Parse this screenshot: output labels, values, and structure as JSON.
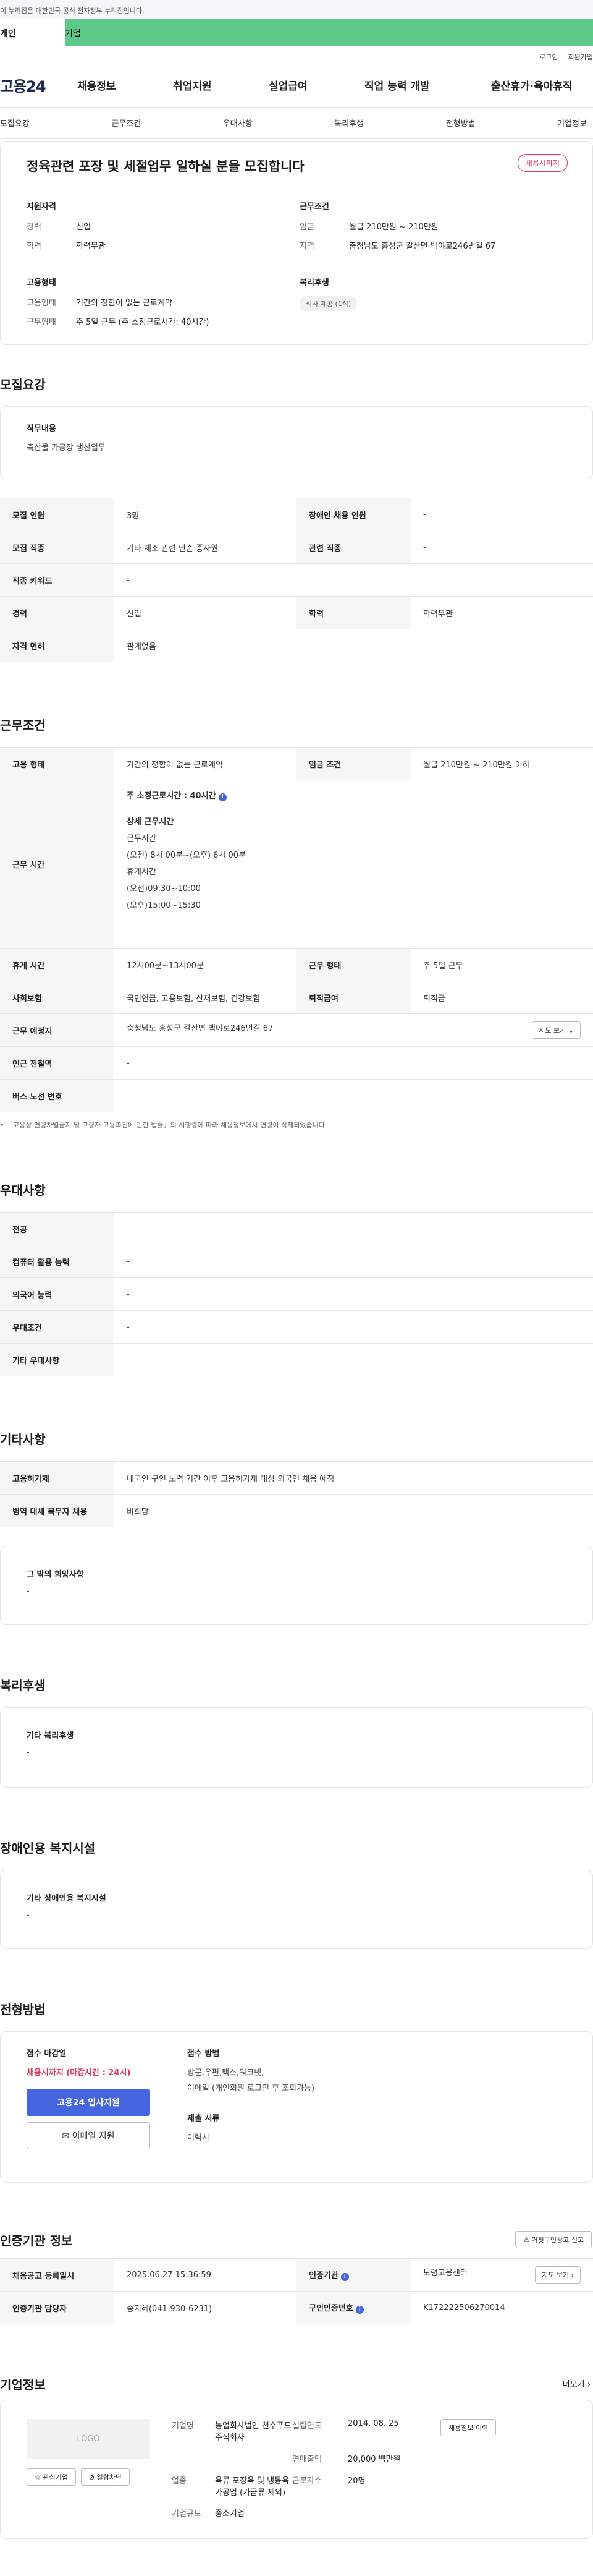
{
  "gov_bar": "이 누리집은 대한민국 공식 전자정부 누리집입니다.",
  "type_tabs": {
    "person": "개인",
    "business": "기업"
  },
  "top_links": {
    "login": "로그인",
    "signup": "회원가입"
  },
  "gnb": {
    "logo": "고용24",
    "items": [
      "채용정보",
      "취업지원",
      "실업급여",
      "직업 능력 개발",
      "출산휴가·육아휴직"
    ]
  },
  "sub_tabs": [
    "모집요강",
    "근무조건",
    "우대사항",
    "복리후생",
    "전형방법",
    "기업정보"
  ],
  "summary": {
    "title": "정육관련 포장 및 세절업무 일하실 분을 모집합니다",
    "status": "채용시까지",
    "qualification": {
      "heading": "지원자격",
      "rows": [
        {
          "k": "경력",
          "v": "신입"
        },
        {
          "k": "학력",
          "v": "학력무관"
        }
      ]
    },
    "conditions": {
      "heading": "근무조건",
      "rows": [
        {
          "k": "임금",
          "v": "월급 210만원 ~ 210만원"
        },
        {
          "k": "지역",
          "v": "충청남도 홍성군 갈산면 백야로246번길 67"
        }
      ]
    },
    "employment": {
      "heading": "고용형태",
      "rows": [
        {
          "k": "고용형태",
          "v": "기간의 정함이 없는 근로계약"
        },
        {
          "k": "근무형태",
          "v": "주 5일 근무 (주 소정근로시간: 40시간)"
        }
      ]
    },
    "welfare": {
      "heading": "복리후생",
      "chip": "식사 제공 (1식)"
    }
  },
  "recruit": {
    "title": "모집요강",
    "duty_label": "직무내용",
    "duty_text": "축산물 가공장 생산업무",
    "rows": [
      [
        "모집 인원",
        "3명",
        "장애인 채용 인원",
        "-"
      ],
      [
        "모집 직종",
        "기타 제조 관련 단순 종사원",
        "관련 직종",
        "-"
      ],
      [
        "직종 키워드",
        "-"
      ],
      [
        "경력",
        "신입",
        "학력",
        "학력무관"
      ],
      [
        "자격 면허",
        "관계없음"
      ]
    ]
  },
  "work": {
    "title": "근무조건",
    "type_k": "고용 형태",
    "type_v": "기간의 정함이 없는 근로계약",
    "wage_k": "임금 조건",
    "wage_v": "월급 210만원 ~ 210만원 이하",
    "hours_k": "근무 시간",
    "hours_main": "주 소정근로시간 : 40시간",
    "hours_detail": [
      "상세 근무시간",
      "근무시간",
      "(오전) 8시 00분~(오후) 6시 00분",
      "휴게시간",
      "(오전)09:30~10:00",
      "(오후)15:00~15:30"
    ],
    "break_k": "휴게 시간",
    "break_v": "12시00분~13시00분",
    "form_k": "근무 형태",
    "form_v": "주 5일 근무",
    "insurance_k": "사회보험",
    "insurance_v": "국민연금, 고용보험, 산재보험, 건강보험",
    "retire_k": "퇴직급여",
    "retire_v": "퇴직금",
    "place_k": "근무 예정지",
    "place_v": "충청남도 홍성군 갈산면 백야로246번길 67",
    "map_btn": "지도 보기",
    "subway_k": "인근 전철역",
    "subway_v": "-",
    "bus_k": "버스 노선 번호",
    "bus_v": "-",
    "note": "「고용상 연령차별금지 및 고령자 고용촉진에 관한 법률」의 시행령에 따라 채용정보에서 연령이 삭제되었습니다."
  },
  "prefer": {
    "title": "우대사항",
    "rows": [
      [
        "전공",
        "-"
      ],
      [
        "컴퓨터 활용 능력",
        "-"
      ],
      [
        "외국어 능력",
        "-"
      ],
      [
        "우대조건",
        "-"
      ],
      [
        "기타 우대사항",
        "-"
      ]
    ]
  },
  "etc": {
    "title": "기타사항",
    "rows": [
      [
        "고용허가제",
        "내국인 구인 노력 기간 이후 고용허가제 대상 외국인 채용 예정"
      ],
      [
        "병역 대체 복무자 채용",
        "비희망"
      ]
    ],
    "other_label": "그 밖의 희망사항",
    "other_value": "-"
  },
  "benefit": {
    "title": "복리후생",
    "label": "기타 복리후생",
    "value": "-"
  },
  "disabled": {
    "title": "장애인용 복지시설",
    "label": "기타 장애인용 복지시설",
    "value": "-"
  },
  "selection": {
    "title": "전형방법",
    "deadline_label": "접수 마감일",
    "deadline_value": "채용시까지 (마감시간 : 24시)",
    "apply_btn": "고용24 입사지원",
    "email_btn": "이메일 지원",
    "method_label": "접수 방법",
    "method_value": "방문,우편,팩스,워크넷,",
    "method_value2": "이메일 (개인회원 로그인 후 조회가능)",
    "docs_label": "제출 서류",
    "docs_value": "이력서"
  },
  "agency": {
    "title": "인증기관 정보",
    "report_btn": "거짓구인광고 신고",
    "reg_k": "채용공고 등록일시",
    "reg_v": "2025.06.27 15:36:59",
    "org_k": "인증기관",
    "org_v": "보령고용센터",
    "map_btn": "지도 보기",
    "staff_k": "인증기관 담당자",
    "staff_v": "송지혜(041-930-6231)",
    "num_k": "구인인증번호",
    "num_v": "K172222506270014"
  },
  "company": {
    "title": "기업정보",
    "more": "더보기",
    "logo_ph": "LOGO",
    "fav_btn": "관심기업",
    "block_btn": "열람차단",
    "name_k": "기업명",
    "name_v": "농업회사법인 천수푸드 주식회사",
    "year_k": "설립연도",
    "year_v": "2014. 08. 25",
    "job_btn": "채용정보 이력",
    "sales_k": "연매출액",
    "sales_v": "20,000 백만원",
    "industry_k": "업종",
    "industry_v": "육류 포장육 및 냉동육 가공업 (가금류 제외)",
    "staff_k": "근로자수",
    "staff_v": "20명",
    "size_k": "기업규모",
    "size_v": "중소기업"
  }
}
